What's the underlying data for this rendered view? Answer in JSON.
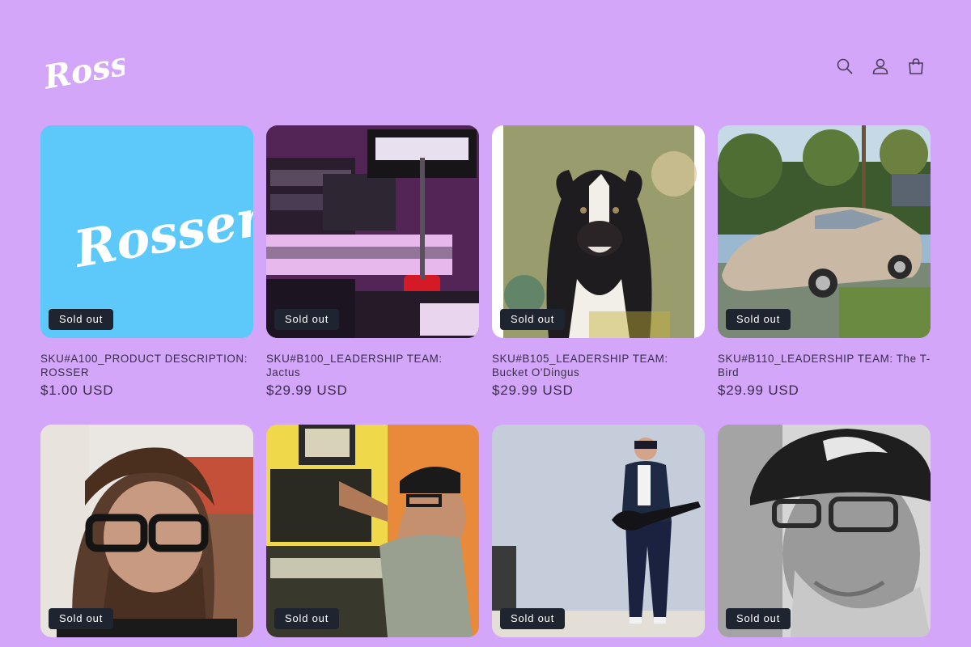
{
  "brand": {
    "logo_text": "Rosser"
  },
  "header": {
    "icons": [
      "search-icon",
      "account-icon",
      "cart-icon"
    ]
  },
  "colors": {
    "background": "#d3a6f9",
    "badge_bg": "#1f2530",
    "badge_text": "#ffffff",
    "logo_tile": "#5dc9fb"
  },
  "products": [
    {
      "title": "SKU#A100_PRODUCT DESCRIPTION: ROSSER",
      "price": "$1.00 USD",
      "badge": "Sold out"
    },
    {
      "title": "SKU#B100_LEADERSHIP TEAM: Jactus",
      "price": "$29.99 USD",
      "badge": "Sold out"
    },
    {
      "title": "SKU#B105_LEADERSHIP TEAM: Bucket O'Dingus",
      "price": "$29.99 USD",
      "badge": "Sold out"
    },
    {
      "title": "SKU#B110_LEADERSHIP TEAM: The T-Bird",
      "price": "$29.99 USD",
      "badge": "Sold out"
    },
    {
      "badge": "Sold out"
    },
    {
      "badge": "Sold out"
    },
    {
      "badge": "Sold out"
    },
    {
      "badge": "Sold out"
    }
  ]
}
